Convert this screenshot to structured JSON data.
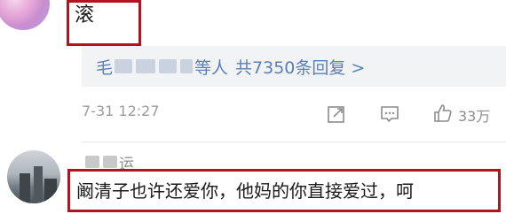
{
  "comment_1": {
    "text": "滚"
  },
  "replies": {
    "name_prefix": "毛",
    "suffix": "等人",
    "count_label": "共7350条回复 >"
  },
  "meta": {
    "timestamp": "7-31 12:27",
    "like_count": "33万"
  },
  "comment_2": {
    "username_visible": "运",
    "text": "阚清子也许还爱你，他妈的你直接爱过，呵"
  },
  "colors": {
    "highlight_border": "#b3131d",
    "link_blue": "#5a7fb8",
    "meta_gray": "#9a9a9a"
  },
  "icons": [
    "share-icon",
    "comment-icon",
    "thumbs-up-icon"
  ]
}
